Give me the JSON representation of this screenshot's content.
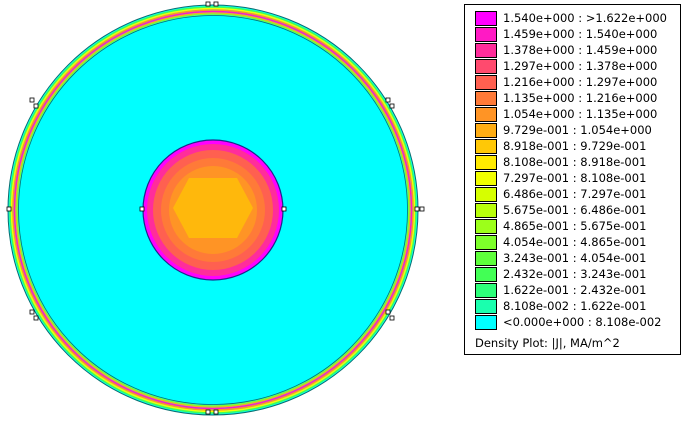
{
  "legend": {
    "title": "Density Plot: |J|, MA/m^2",
    "entries": [
      {
        "label": "1.540e+000 : >1.622e+000",
        "color": "#ff00ff"
      },
      {
        "label": "1.459e+000 : 1.540e+000",
        "color": "#ff1ac4"
      },
      {
        "label": "1.378e+000 : 1.459e+000",
        "color": "#ff2d9b"
      },
      {
        "label": "1.297e+000 : 1.378e+000",
        "color": "#ff4a6e"
      },
      {
        "label": "1.216e+000 : 1.297e+000",
        "color": "#ff6050"
      },
      {
        "label": "1.135e+000 : 1.216e+000",
        "color": "#ff7a38"
      },
      {
        "label": "1.054e+000 : 1.135e+000",
        "color": "#ff9425"
      },
      {
        "label": "9.729e-001 : 1.054e+000",
        "color": "#ffad14"
      },
      {
        "label": "8.918e-001 : 9.729e-001",
        "color": "#ffc806"
      },
      {
        "label": "8.108e-001 : 8.918e-001",
        "color": "#ffea00"
      },
      {
        "label": "7.297e-001 : 8.108e-001",
        "color": "#f2ff00"
      },
      {
        "label": "6.486e-001 : 7.297e-001",
        "color": "#d6ff00"
      },
      {
        "label": "5.675e-001 : 6.486e-001",
        "color": "#b9ff0b"
      },
      {
        "label": "4.865e-001 : 5.675e-001",
        "color": "#9cff1a"
      },
      {
        "label": "4.054e-001 : 4.865e-001",
        "color": "#7dff2a"
      },
      {
        "label": "3.243e-001 : 4.054e-001",
        "color": "#5eff3b"
      },
      {
        "label": "2.432e-001 : 3.243e-001",
        "color": "#42ff55"
      },
      {
        "label": "1.622e-001 : 2.432e-001",
        "color": "#2dff7a"
      },
      {
        "label": "8.108e-002 : 1.622e-001",
        "color": "#1affae"
      },
      {
        "label": "<0.000e+000 : 8.108e-002",
        "color": "#00ffff"
      }
    ]
  }
}
